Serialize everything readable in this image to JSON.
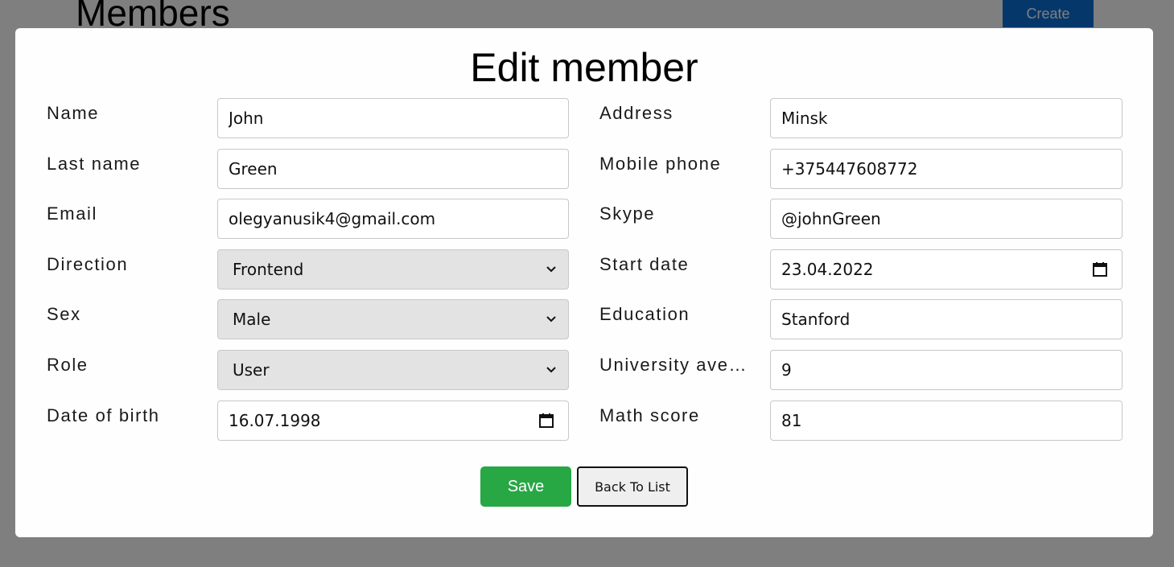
{
  "background": {
    "title": "Members",
    "create_label": "Create"
  },
  "modal": {
    "title": "Edit member",
    "left_fields": [
      {
        "label": "Name",
        "value": "John",
        "type": "text"
      },
      {
        "label": "Last name",
        "value": "Green",
        "type": "text"
      },
      {
        "label": "Email",
        "value": "olegyanusik4@gmail.com",
        "type": "text"
      },
      {
        "label": "Direction",
        "value": "Frontend",
        "type": "select"
      },
      {
        "label": "Sex",
        "value": "Male",
        "type": "select"
      },
      {
        "label": "Role",
        "value": "User",
        "type": "select"
      },
      {
        "label": "Date of birth",
        "value": "16.07.1998",
        "type": "date"
      }
    ],
    "right_fields": [
      {
        "label": "Address",
        "value": "Minsk",
        "type": "text"
      },
      {
        "label": "Mobile phone",
        "value": "+375447608772",
        "type": "text"
      },
      {
        "label": "Skype",
        "value": "@johnGreen",
        "type": "text"
      },
      {
        "label": "Start date",
        "value": "23.04.2022",
        "type": "date"
      },
      {
        "label": "Education",
        "value": "Stanford",
        "type": "text"
      },
      {
        "label": "University ave…",
        "value": "9",
        "type": "text"
      },
      {
        "label": "Math score",
        "value": "81",
        "type": "text"
      }
    ],
    "save_label": "Save",
    "back_label": "Back To List"
  },
  "colors": {
    "save": "#28a745",
    "select_bg": "#e3e3e3",
    "create": "#0a6fd6"
  }
}
